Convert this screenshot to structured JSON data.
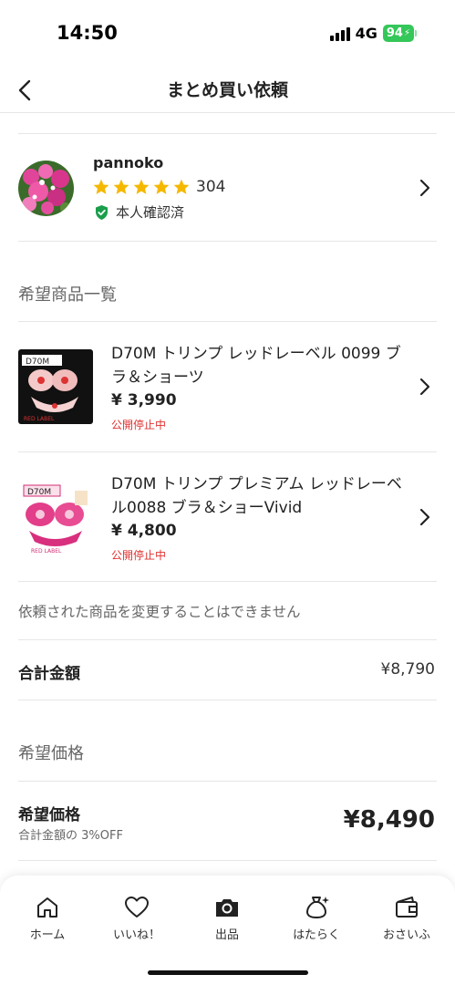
{
  "status_bar": {
    "time": "14:50",
    "network": "4G",
    "battery": "94"
  },
  "nav": {
    "title": "まとめ買い依頼"
  },
  "seller": {
    "name": "pannoko",
    "rating_count": "304",
    "verified_label": "本人確認済",
    "stars": 5
  },
  "items_section": {
    "title": "希望商品一覧"
  },
  "items": [
    {
      "name": "D70M トリンプ レッドレーベル 0099 ブラ＆ショーツ",
      "price": "¥ 3,990",
      "status": "公開停止中"
    },
    {
      "name": "D70M トリンプ プレミアム レッドレーベル0088 ブラ＆ショーVivid",
      "price": "¥ 4,800",
      "status": "公開停止中"
    }
  ],
  "note": "依頼された商品を変更することはできません",
  "total": {
    "label": "合計金額",
    "value": "¥8,790"
  },
  "desired_section": {
    "title": "希望価格"
  },
  "desired_price": {
    "label": "希望価格",
    "sub": "合計金額の 3%OFF",
    "value": "¥8,490"
  },
  "tabs": [
    {
      "label": "ホーム",
      "icon": "home-icon"
    },
    {
      "label": "いいね！",
      "icon": "heart-icon"
    },
    {
      "label": "出品",
      "icon": "camera-icon"
    },
    {
      "label": "はたらく",
      "icon": "money-bag-icon"
    },
    {
      "label": "おさいふ",
      "icon": "wallet-icon"
    }
  ],
  "colors": {
    "accent_star": "#f5b800",
    "status_red": "#e0302f",
    "verified_green": "#1a9e4b",
    "battery_green": "#34c759"
  }
}
